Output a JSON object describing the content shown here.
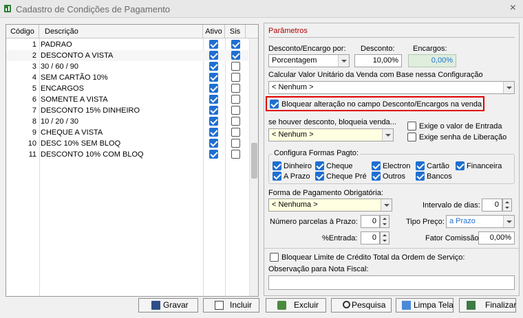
{
  "window": {
    "title": "Cadastro de Condições de Pagamento",
    "close": "×"
  },
  "grid": {
    "headers": {
      "codigo": "Código",
      "descricao": "Descrição",
      "ativo": "Ativo",
      "sis": "Sis"
    },
    "rows": [
      {
        "codigo": "1",
        "descricao": "PADRAO",
        "ativo": true,
        "sis": true
      },
      {
        "codigo": "2",
        "descricao": "DESCONTO A VISTA",
        "ativo": true,
        "sis": true
      },
      {
        "codigo": "3",
        "descricao": "30 / 60 / 90",
        "ativo": true,
        "sis": false
      },
      {
        "codigo": "4",
        "descricao": "SEM CARTÃO 10%",
        "ativo": true,
        "sis": false
      },
      {
        "codigo": "5",
        "descricao": "ENCARGOS",
        "ativo": true,
        "sis": false
      },
      {
        "codigo": "6",
        "descricao": "SOMENTE A VISTA",
        "ativo": true,
        "sis": false
      },
      {
        "codigo": "7",
        "descricao": "DESCONTO 15% DINHEIRO",
        "ativo": true,
        "sis": false
      },
      {
        "codigo": "8",
        "descricao": "10 / 20 / 30",
        "ativo": true,
        "sis": false
      },
      {
        "codigo": "9",
        "descricao": "CHEQUE A VISTA",
        "ativo": true,
        "sis": false
      },
      {
        "codigo": "10",
        "descricao": "DESC 10% SEM BLOQ",
        "ativo": true,
        "sis": false
      },
      {
        "codigo": "11",
        "descricao": "DESCONTO 10% COM BLOQ",
        "ativo": true,
        "sis": false
      }
    ]
  },
  "params": {
    "title": "Parâmetros",
    "desc_enc_label": "Desconto/Encargo por:",
    "desc_enc_value": "Porcentagem",
    "desconto_label": "Desconto:",
    "desconto_value": "10,00%",
    "encargos_label": "Encargos:",
    "encargos_value": "0,00%",
    "calc_label": "Calcular Valor Unitário da Venda com Base nessa Configuração",
    "calc_value": "< Nenhum >",
    "bloquear_label": "Bloquear alteração no campo Desconto/Encargos na venda",
    "bloquear_checked": true,
    "se_houver_label": "se houver desconto, bloqueia venda...",
    "se_houver_value": "< Nenhum >",
    "exige_entrada_label": "Exige o valor de Entrada",
    "exige_senha_label": "Exige senha de Liberação",
    "formas_title": "Configura Formas Pagto:",
    "formas": [
      "Dinheiro",
      "Cheque",
      "Electron",
      "Cartão",
      "Financeira",
      "A Prazo",
      "Cheque Pré",
      "Outros",
      "Bancos"
    ],
    "forma_obrig_label": "Forma de Pagamento Obrigatória:",
    "forma_obrig_value": "< Nenhuma >",
    "intervalo_label": "Intervalo de dias:",
    "intervalo_value": "0",
    "parcelas_label": "Número parcelas à Prazo:",
    "parcelas_value": "0",
    "tipo_preco_label": "Tipo Preço:",
    "tipo_preco_value": "a Prazo",
    "entrada_label": "%Entrada:",
    "entrada_value": "0",
    "fator_label": "Fator Comissão:",
    "fator_value": "0,00%",
    "bloquear_limite_label": "Bloquear Limite de Crédito Total da Ordem de Serviço:",
    "obs_label": "Observação para Nota Fiscal:",
    "obs_value": ""
  },
  "buttons": {
    "gravar": "Gravar",
    "incluir": "Incluir",
    "excluir": "Excluir",
    "pesquisa": "Pesquisa",
    "limpa": "Limpa Tela",
    "finalizar": "Finalizar"
  },
  "colors": {
    "accent": "#1f6fd1",
    "highlight": "#e00000",
    "params_title": "#b00000"
  }
}
